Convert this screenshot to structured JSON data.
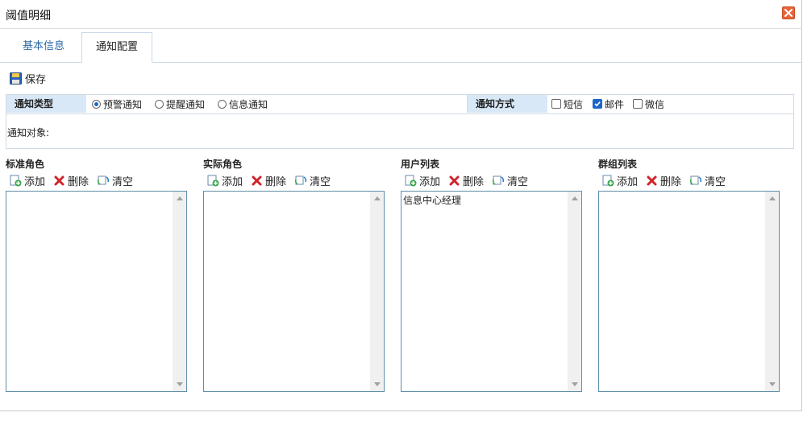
{
  "window": {
    "title": "阈值明细"
  },
  "tabs": [
    {
      "label": "基本信息"
    },
    {
      "label": "通知配置"
    }
  ],
  "toolbar": {
    "save_label": "保存"
  },
  "form": {
    "notify_type_label": "通知类型",
    "notify_types": [
      {
        "label": "预警通知",
        "selected": true
      },
      {
        "label": "提醒通知",
        "selected": false
      },
      {
        "label": "信息通知",
        "selected": false
      }
    ],
    "notify_method_label": "通知方式",
    "notify_methods": [
      {
        "label": "短信",
        "checked": false
      },
      {
        "label": "邮件",
        "checked": true
      },
      {
        "label": "微信",
        "checked": false
      }
    ],
    "target_label": "通知对象:"
  },
  "panels": [
    {
      "title": "标准角色",
      "add": "添加",
      "delete": "删除",
      "clear": "清空",
      "items": []
    },
    {
      "title": "实际角色",
      "add": "添加",
      "delete": "删除",
      "clear": "清空",
      "items": []
    },
    {
      "title": "用户列表",
      "add": "添加",
      "delete": "删除",
      "clear": "清空",
      "items": [
        "信息中心经理"
      ]
    },
    {
      "title": "群组列表",
      "add": "添加",
      "delete": "删除",
      "clear": "清空",
      "items": []
    }
  ],
  "colors": {
    "accent": "#1a66c8",
    "tab_text": "#2b6aa6",
    "label_bg": "#d8e8f7",
    "close": "#e8643a"
  }
}
